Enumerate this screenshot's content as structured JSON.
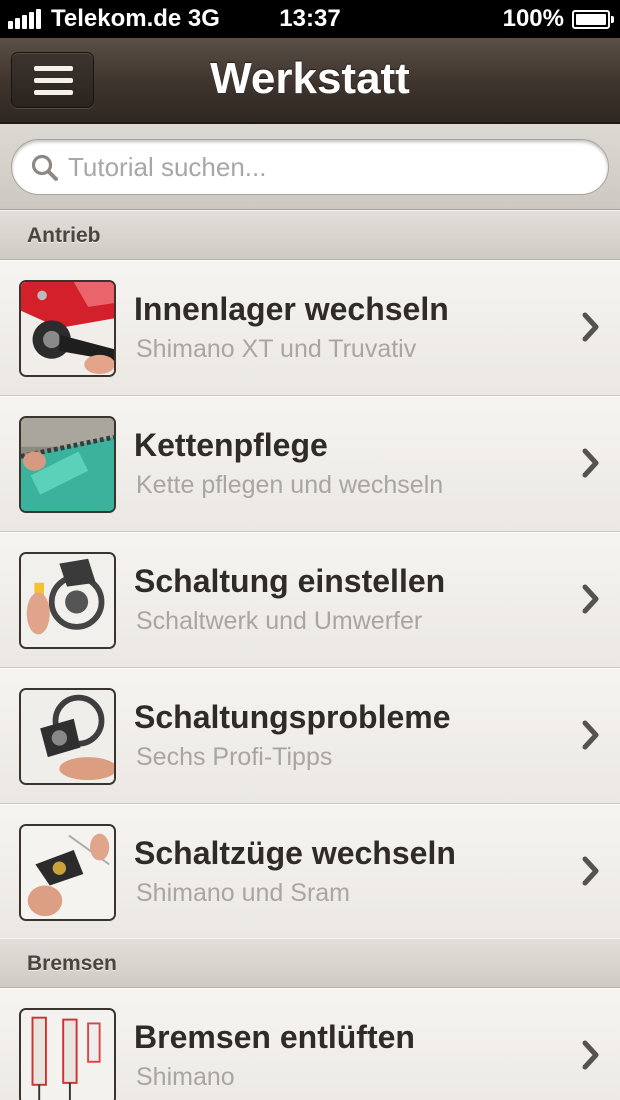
{
  "status_bar": {
    "carrier": "Telekom.de 3G",
    "time": "13:37",
    "battery": "100%",
    "battery_level": 1.0,
    "signal_bars": 5
  },
  "nav": {
    "title": "Werkstatt",
    "menu_icon": "hamburger-icon"
  },
  "search": {
    "placeholder": "Tutorial suchen...",
    "value": "",
    "icon": "search-icon"
  },
  "sections": [
    {
      "header": "Antrieb",
      "items": [
        {
          "title": "Innenlager wechseln",
          "subtitle": "Shimano XT und Truvativ",
          "thumbnail": "bottom-bracket-photo"
        },
        {
          "title": "Kettenpflege",
          "subtitle": "Kette pflegen und wechseln",
          "thumbnail": "chain-care-photo"
        },
        {
          "title": "Schaltung einstellen",
          "subtitle": "Schaltwerk und Umwerfer",
          "thumbnail": "derailleur-adjust-photo"
        },
        {
          "title": "Schaltungsprobleme",
          "subtitle": "Sechs Profi-Tipps",
          "thumbnail": "shifting-problems-photo"
        },
        {
          "title": "Schaltzüge wechseln",
          "subtitle": "Shimano und Sram",
          "thumbnail": "shift-cable-photo"
        }
      ]
    },
    {
      "header": "Bremsen",
      "items": [
        {
          "title": "Bremsen entlüften",
          "subtitle": "Shimano",
          "thumbnail": "brake-bleed-photo"
        }
      ]
    }
  ],
  "colors": {
    "navbar": "#3e342d",
    "background": "#efede8",
    "title_text": "#2e2b28",
    "subtitle_text": "#a9a6a1"
  }
}
